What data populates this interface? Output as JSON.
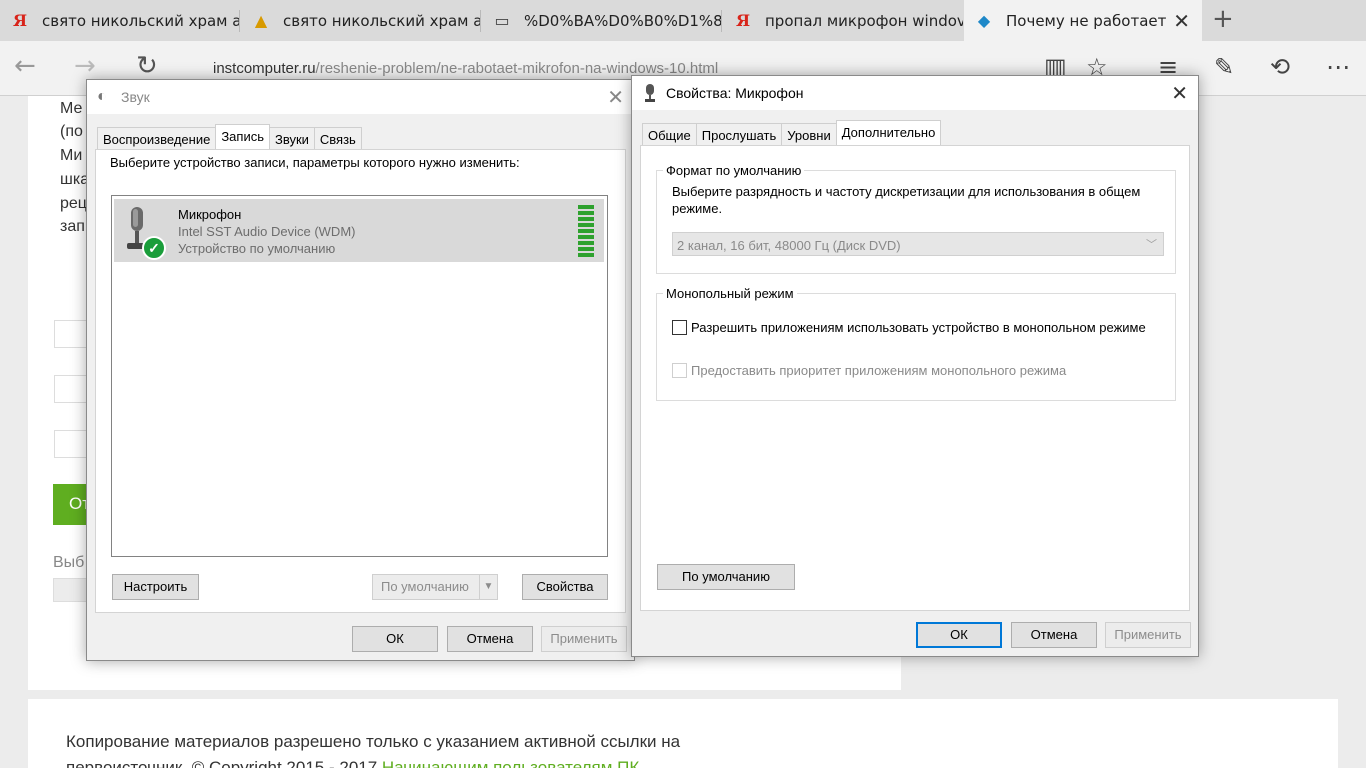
{
  "browser": {
    "tabs": [
      {
        "icon": "yandex-icon",
        "icon_glyph": "Я",
        "title": "свято никольский храм ар"
      },
      {
        "icon": "image-icon",
        "icon_glyph": "▲",
        "title": "свято никольский храм ар"
      },
      {
        "icon": "page-icon",
        "icon_glyph": "▭",
        "title": "%D0%BA%D0%B0%D1%8"
      },
      {
        "icon": "yandex-icon",
        "icon_glyph": "Я",
        "title": "пропал микрофон windov"
      },
      {
        "icon": "site-icon",
        "icon_glyph": "◆",
        "title": "Почему не работает м",
        "active": true
      }
    ],
    "url_domain": "instcomputer.ru",
    "url_path": "/reshenie-problem/ne-rabotaet-mikrofon-na-windows-10.html"
  },
  "page": {
    "left_fragments": [
      "Ме",
      "(по",
      "Ми",
      "шка",
      "рец",
      "зап"
    ],
    "green_button_text": "От",
    "select_label_fragment": "Выб",
    "footer_text": "Копирование материалов разрешено только с указанием активной ссылки на первоисточник. © Copyright 2015 - 2017 ",
    "footer_link": "Начинающим пользователям ПК"
  },
  "sound_dialog": {
    "title": "Звук",
    "tabs": [
      "Воспроизведение",
      "Запись",
      "Звуки",
      "Связь"
    ],
    "selected_tab": "Запись",
    "instruction": "Выберите устройство записи, параметры которого нужно изменить:",
    "device": {
      "name": "Микрофон",
      "driver": "Intel SST Audio Device (WDM)",
      "status": "Устройство по умолчанию",
      "level_bars": 9
    },
    "configure_button": "Настроить",
    "default_button": "По умолчанию",
    "properties_button": "Свойства",
    "ok_button": "ОК",
    "cancel_button": "Отмена",
    "apply_button": "Применить"
  },
  "props_dialog": {
    "title": "Свойства: Микрофон",
    "tabs": [
      "Общие",
      "Прослушать",
      "Уровни",
      "Дополнительно"
    ],
    "selected_tab": "Дополнительно",
    "default_format_group": "Формат по умолчанию",
    "default_format_desc": "Выберите разрядность и частоту дискретизации для использования в общем режиме.",
    "format_value": "2 канал, 16 бит, 48000 Гц (Диск DVD)",
    "exclusive_group": "Монопольный режим",
    "exclusive_allow": "Разрешить приложениям использовать устройство в монопольном режиме",
    "exclusive_priority": "Предоставить приоритет приложениям монопольного режима",
    "restore_defaults_button": "По умолчанию",
    "ok_button": "ОК",
    "cancel_button": "Отмена",
    "apply_button": "Применить"
  },
  "colors": {
    "accent": "#0078d7",
    "green": "#5fae20",
    "meter": "#2ea12e"
  }
}
